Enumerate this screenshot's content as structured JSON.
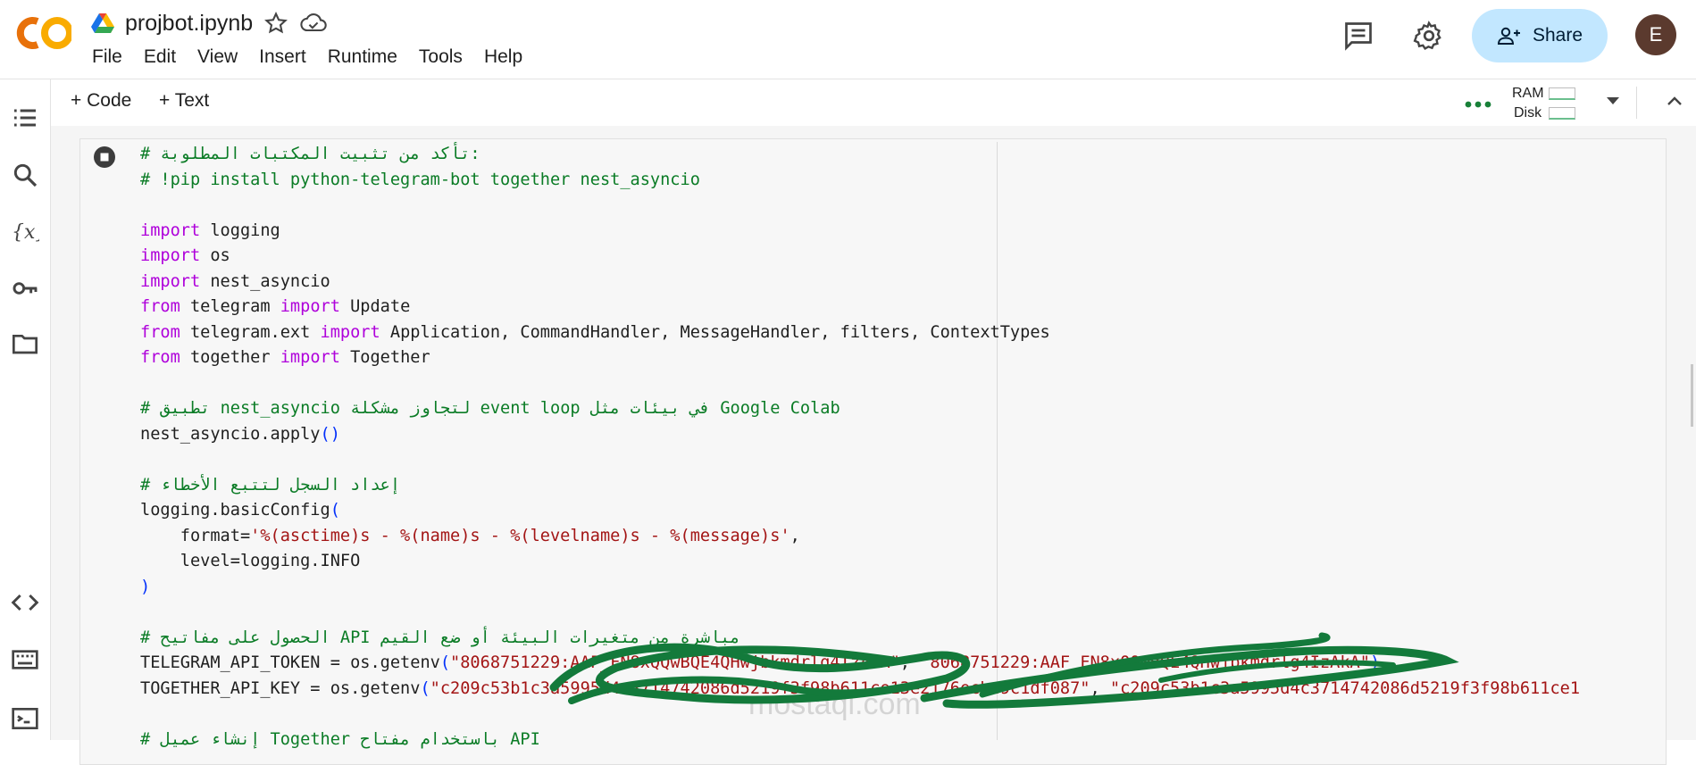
{
  "app": {
    "logo": "colab-logo",
    "notebook_title": "projbot.ipynb"
  },
  "menu": [
    "File",
    "Edit",
    "View",
    "Insert",
    "Runtime",
    "Tools",
    "Help"
  ],
  "header_actions": {
    "share_label": "Share",
    "avatar_initial": "E"
  },
  "toolbar": {
    "add_code": "+ Code",
    "add_text": "+ Text",
    "ram_label": "RAM",
    "disk_label": "Disk"
  },
  "code": {
    "l1": "# تأكد من تثبيت المكتبات المطلوبة:",
    "l2": "# !pip install python-telegram-bot together nest_asyncio",
    "l4a": "import",
    "l4b": " logging",
    "l5a": "import",
    "l5b": " os",
    "l6a": "import",
    "l6b": " nest_asyncio",
    "l7a": "from",
    "l7b": " telegram ",
    "l7c": "import",
    "l7d": " Update",
    "l8a": "from",
    "l8b": " telegram.ext ",
    "l8c": "import",
    "l8d": " Application, CommandHandler, MessageHandler, filters, ContextTypes",
    "l9a": "from",
    "l9b": " together ",
    "l9c": "import",
    "l9d": " Together",
    "l11": "# تطبيق nest_asyncio لتجاوز مشكلة event loop في بيئات مثل Google Colab",
    "l12a": "nest_asyncio.apply",
    "l12b": "()",
    "l14": "# إعداد السجل لتتبع الأخطاء",
    "l15a": "logging.basicConfig",
    "l15b": "(",
    "l16a": "    format=",
    "l16b": "'%(asctime)s - %(name)s - %(levelname)s - %(message)s'",
    "l16c": ",",
    "l17": "    level=logging.INFO",
    "l18": ")",
    "l20": "# الحصول على مفاتيح API مباشرة من متغيرات البيئة أو ضع القيم",
    "l21a": "TELEGRAM_API_TOKEN = os.getenv",
    "l21b": "(",
    "l21c": "\"8068751229:AAF_FN8xQQwBQE4QHwjbkmdrlg4IzAkA\"",
    "l21d": ", ",
    "l21e": "\"8068751229:AAF_FN8xQQwBQE4QHwjbkmdrlg4IzAkA\"",
    "l21f": ")",
    "l22a": "TOGETHER_API_KEY = os.getenv",
    "l22b": "(",
    "l22c": "\"c209c53b1c3a5995d4c3714742086d5219f3f98b611ce13e2176ecbe9c1df087\"",
    "l22d": ", ",
    "l22e": "\"c209c53b1c3a5995d4c3714742086d5219f3f98b611ce1",
    "l24": "# إنشاء عميل Together باستخدام مفتاح API"
  },
  "watermark": "mostaql.com",
  "colors": {
    "comment": "#0b7c26",
    "keyword": "#af00db",
    "string": "#a31515",
    "share_bg": "#c2e7ff"
  }
}
